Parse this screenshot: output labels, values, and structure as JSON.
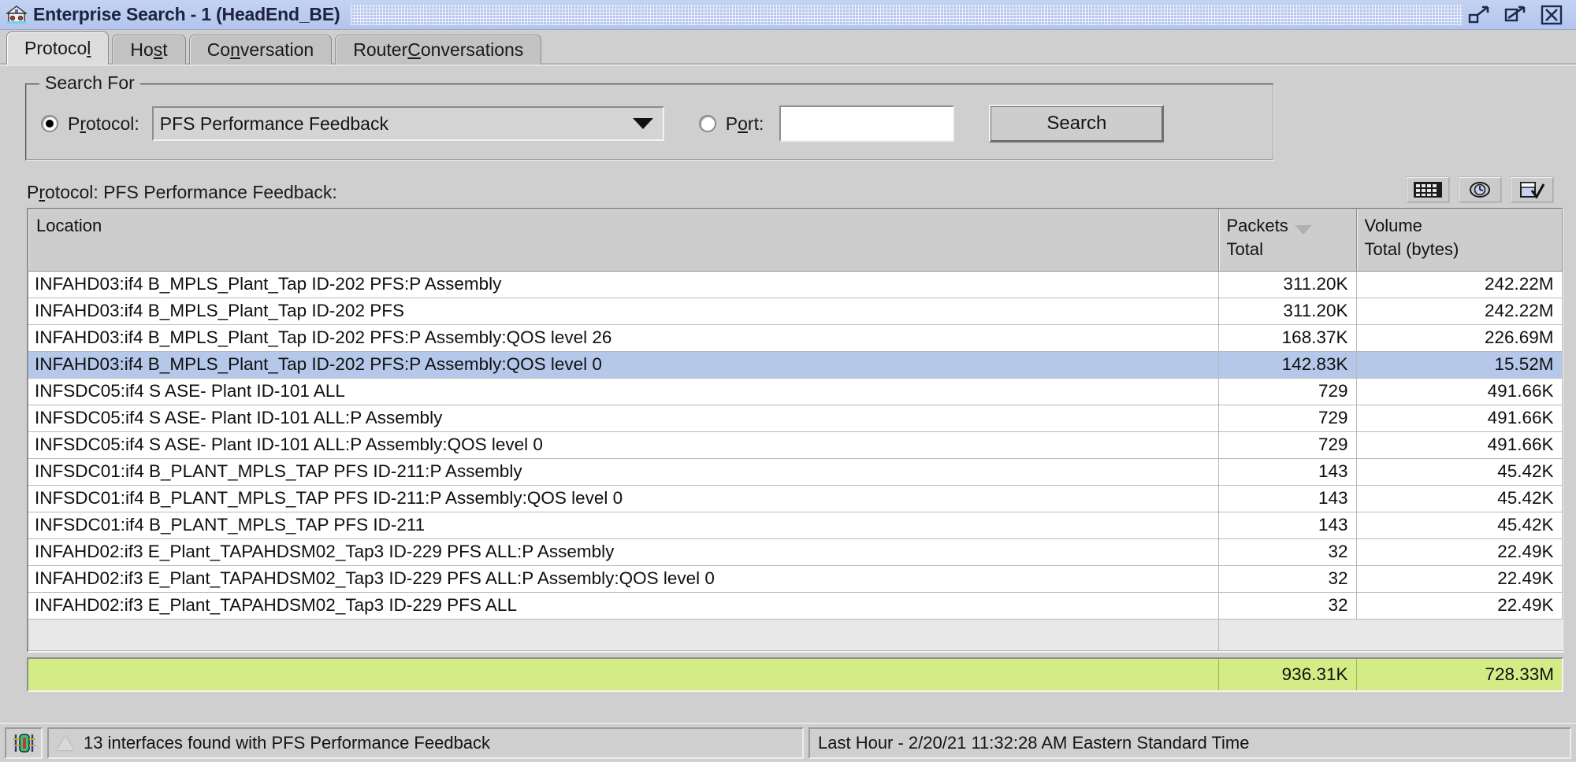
{
  "window": {
    "title": "Enterprise Search - 1 (HeadEnd_BE)",
    "icon": "house-icon",
    "controls": [
      {
        "name": "minimize-button",
        "icon": "minimize-icon"
      },
      {
        "name": "maximize-button",
        "icon": "maximize-icon"
      },
      {
        "name": "close-button",
        "icon": "close-icon"
      }
    ]
  },
  "tabs": [
    {
      "label": "Protoco",
      "mnemonic": "l",
      "tail": "",
      "active": true
    },
    {
      "label": "Ho",
      "mnemonic": "s",
      "tail": "t",
      "active": false
    },
    {
      "label": "Co",
      "mnemonic": "n",
      "tail": "versation",
      "active": false
    },
    {
      "label": "Router ",
      "mnemonic": "C",
      "tail": "onversations",
      "active": false
    }
  ],
  "search_group": {
    "legend": "Search For",
    "protocol_radio": {
      "label_pre": "P",
      "label_mn": "r",
      "label_post": "otocol:",
      "checked": true
    },
    "protocol_combo": {
      "value": "PFS Performance Feedback",
      "arrow": "chevron-down-icon"
    },
    "port_radio": {
      "label_pre": "P",
      "label_mn": "o",
      "label_post": "rt:",
      "checked": false
    },
    "port_input": {
      "value": "",
      "placeholder": ""
    },
    "search_button": "Search"
  },
  "results": {
    "title_pre": "P",
    "title_mn": "r",
    "title_post": "otocol: PFS Performance Feedback:",
    "toolbar": [
      {
        "name": "grid-view-button",
        "icon": "grid-icon"
      },
      {
        "name": "history-view-button",
        "icon": "clock-eye-icon"
      },
      {
        "name": "report-export-button",
        "icon": "document-check-icon"
      }
    ],
    "columns": [
      {
        "line1": "Location",
        "line2": "",
        "sorted": false
      },
      {
        "line1": "Packets",
        "line2": "Total",
        "sorted": true,
        "sort_dir": "desc"
      },
      {
        "line1": "Volume",
        "line2": "Total (bytes)",
        "sorted": false
      }
    ],
    "rows": [
      {
        "location": "INFAHD03:if4 B_MPLS_Plant_Tap ID-202 PFS:P  Assembly",
        "packets": "311.20K",
        "volume": "242.22M",
        "selected": false
      },
      {
        "location": "INFAHD03:if4 B_MPLS_Plant_Tap ID-202 PFS",
        "packets": "311.20K",
        "volume": "242.22M",
        "selected": false
      },
      {
        "location": "INFAHD03:if4 B_MPLS_Plant_Tap ID-202 PFS:P  Assembly:QOS level 26",
        "packets": "168.37K",
        "volume": "226.69M",
        "selected": false
      },
      {
        "location": "INFAHD03:if4 B_MPLS_Plant_Tap ID-202 PFS:P  Assembly:QOS level 0",
        "packets": "142.83K",
        "volume": "15.52M",
        "selected": true
      },
      {
        "location": "INFSDC05:if4  S ASE- Plant  ID-101 ALL",
        "packets": "729",
        "volume": "491.66K",
        "selected": false
      },
      {
        "location": "INFSDC05:if4  S ASE- Plant  ID-101 ALL:P  Assembly",
        "packets": "729",
        "volume": "491.66K",
        "selected": false
      },
      {
        "location": "INFSDC05:if4  S ASE- Plant  ID-101 ALL:P  Assembly:QOS level 0",
        "packets": "729",
        "volume": "491.66K",
        "selected": false
      },
      {
        "location": "INFSDC01:if4 B_PLANT_MPLS_TAP PFS ID-211:P  Assembly",
        "packets": "143",
        "volume": "45.42K",
        "selected": false
      },
      {
        "location": "INFSDC01:if4 B_PLANT_MPLS_TAP PFS ID-211:P  Assembly:QOS level 0",
        "packets": "143",
        "volume": "45.42K",
        "selected": false
      },
      {
        "location": "INFSDC01:if4 B_PLANT_MPLS_TAP PFS ID-211",
        "packets": "143",
        "volume": "45.42K",
        "selected": false
      },
      {
        "location": "INFAHD02:if3  E_Plant_TAPAHDSM02_Tap3 ID-229 PFS ALL:P  Assembly",
        "packets": "32",
        "volume": "22.49K",
        "selected": false
      },
      {
        "location": "INFAHD02:if3  E_Plant_TAPAHDSM02_Tap3 ID-229 PFS ALL:P  Assembly:QOS level 0",
        "packets": "32",
        "volume": "22.49K",
        "selected": false
      },
      {
        "location": "INFAHD02:if3  E_Plant_TAPAHDSM02_Tap3 ID-229 PFS ALL",
        "packets": "32",
        "volume": "22.49K",
        "selected": false
      }
    ],
    "totals": {
      "location": "",
      "packets": "936.31K",
      "volume": "728.33M"
    }
  },
  "statusbar": {
    "icon": "interface-icon",
    "warning_icon": "triangle-icon",
    "message": "13 interfaces found with PFS Performance Feedback",
    "timerange": "Last Hour - 2/20/21 11:32:28 AM Eastern Standard Time"
  },
  "colors": {
    "titlebar": "#bdcdf0",
    "selection": "#b6c8ea",
    "totals_row": "#d3ec86",
    "face": "#cfcfcf"
  }
}
